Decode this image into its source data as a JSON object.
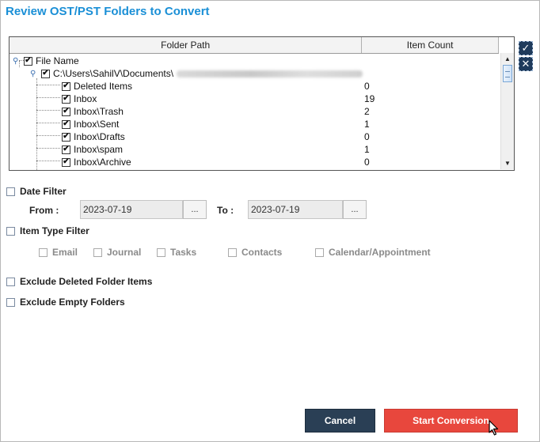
{
  "title": "Review OST/PST Folders to Convert",
  "table": {
    "col_folder_path": "Folder Path",
    "col_item_count": "Item Count",
    "root": "File Name",
    "path_prefix": "C:\\Users\\SahilV\\Documents\\",
    "rows": [
      {
        "name": "Deleted Items",
        "count": "0"
      },
      {
        "name": "Inbox",
        "count": "19"
      },
      {
        "name": "Inbox\\Trash",
        "count": "2"
      },
      {
        "name": "Inbox\\Sent",
        "count": "1"
      },
      {
        "name": "Inbox\\Drafts",
        "count": "0"
      },
      {
        "name": "Inbox\\spam",
        "count": "1"
      },
      {
        "name": "Inbox\\Archive",
        "count": "0"
      }
    ],
    "check_mark": "✔"
  },
  "side_icons": [
    "check-all-icon",
    "uncheck-all-icon"
  ],
  "date_filter": {
    "label": "Date Filter",
    "from_label": "From :",
    "to_label": "To :",
    "from_value": "2023-07-19",
    "to_value": "2023-07-19",
    "browse_label": "..."
  },
  "item_type_filter": {
    "label": "Item Type Filter",
    "types": [
      "Email",
      "Journal",
      "Tasks",
      "Contacts",
      "Calendar/Appointment"
    ]
  },
  "options": {
    "exclude_deleted": "Exclude Deleted Folder Items",
    "exclude_empty": "Exclude Empty Folders"
  },
  "buttons": {
    "cancel": "Cancel",
    "start": "Start Conversion"
  },
  "colors": {
    "title": "#1a8fd6",
    "cancel_bg": "#2a3f55",
    "start_bg": "#e8473d"
  }
}
